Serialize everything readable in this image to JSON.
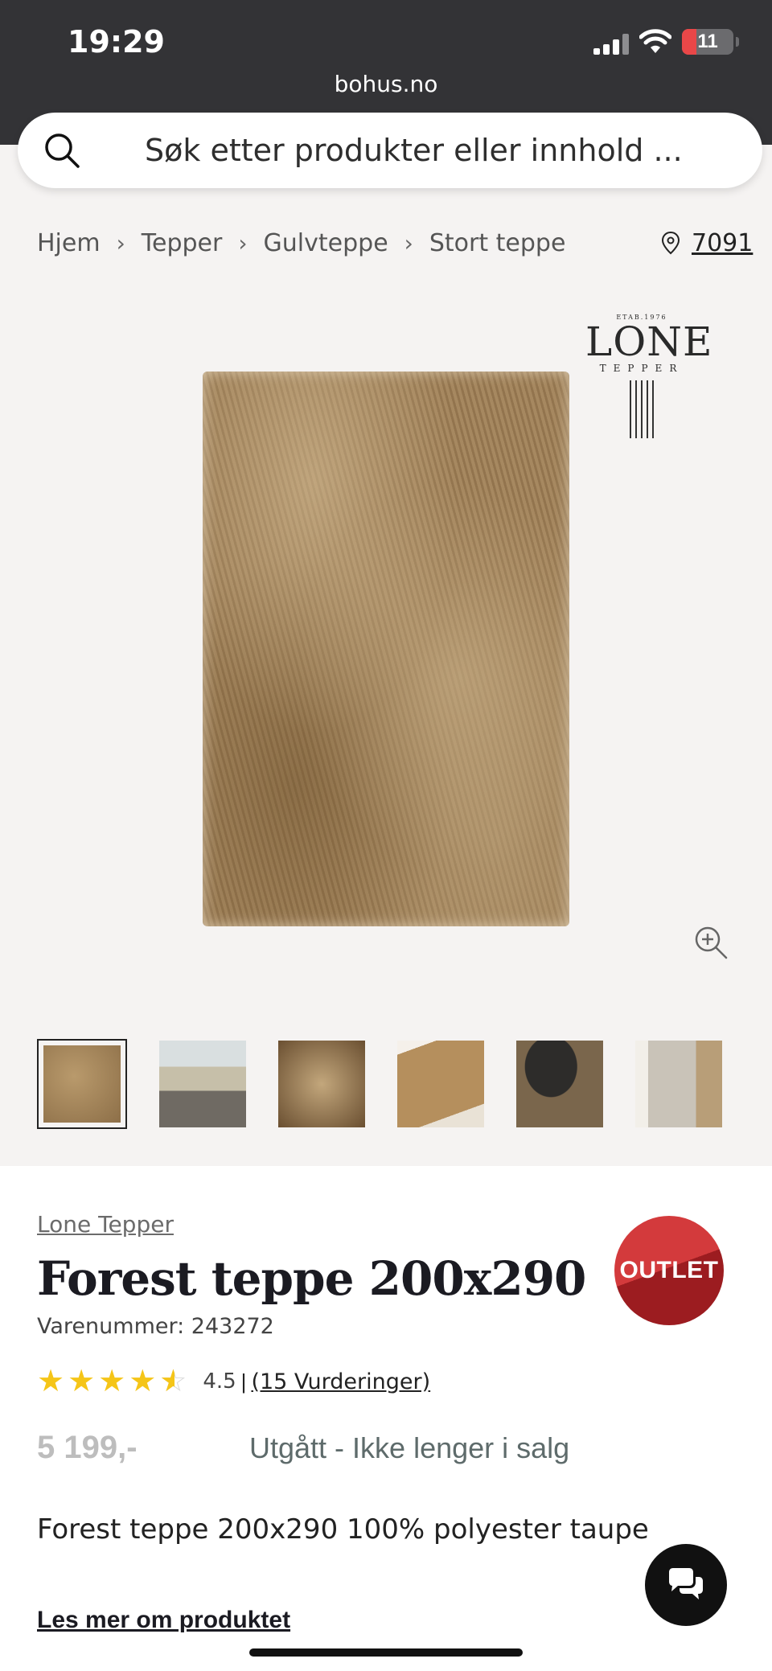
{
  "status_bar": {
    "time": "19:29",
    "battery": "11"
  },
  "browser": {
    "url": "bohus.no"
  },
  "search": {
    "placeholder": "Søk etter produkter eller innhold ..."
  },
  "breadcrumb": {
    "items": [
      "Hjem",
      "Tepper",
      "Gulvteppe",
      "Stort teppe"
    ],
    "zip": "7091"
  },
  "gallery": {
    "logo": {
      "etab": "ETAB.1976",
      "name": "LONE",
      "sub": "TEPPER"
    },
    "thumbnail_count": 6,
    "selected_thumbnail": 1
  },
  "product": {
    "brand": "Lone Tepper",
    "title": "Forest teppe 200x290",
    "sku": "Varenummer: 243272",
    "rating_value": "4.5",
    "rating_fraction": 0.9,
    "rating_separator": "|",
    "reviews": "(15 Vurderinger)",
    "price": "5 199,-",
    "status": "Utgått - Ikke lenger i salg",
    "badge": "OUTLET",
    "description": "Forest teppe 200x290 100% polyester taupe",
    "read_more": "Les mer om produktet"
  },
  "colors": {
    "header_bg": "#333336",
    "badge_red": "#c0282c",
    "star_yellow": "#f5c518",
    "battery_red": "#e94748"
  }
}
